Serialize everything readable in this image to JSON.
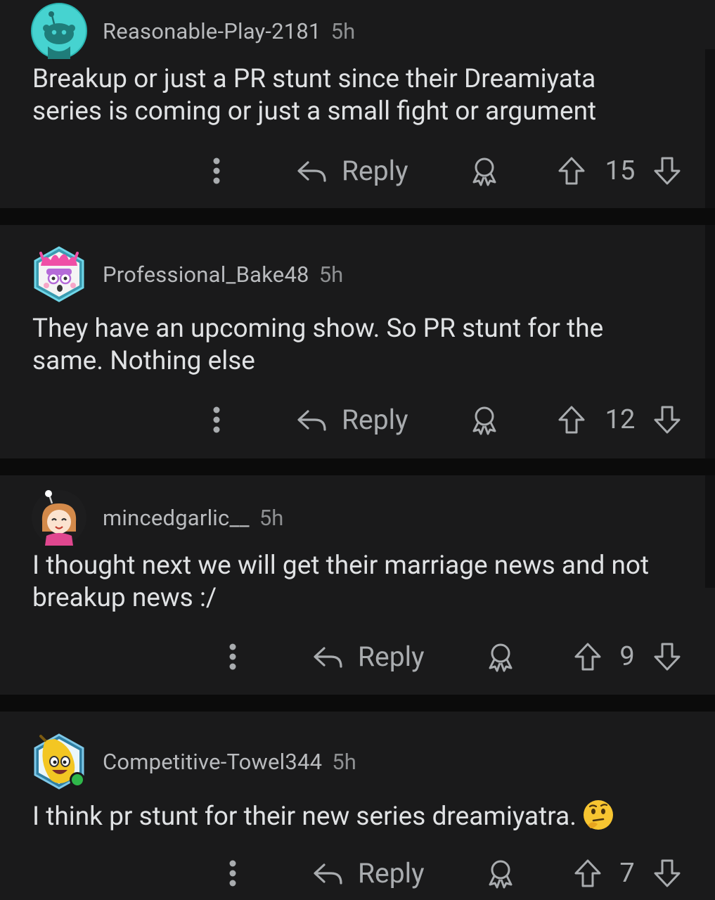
{
  "comments": [
    {
      "username": "Reasonable-Play-2181",
      "time": "5h",
      "text": "Breakup or just a PR stunt since their Dreamiyata series is coming or just a small fight or argument",
      "reply_label": "Reply",
      "score": "15",
      "avatar": "snoo-default-cyan-avatar"
    },
    {
      "username": "Professional_Bake48",
      "time": "5h",
      "text": "They have an upcoming show. So PR stunt for the same. Nothing else",
      "reply_label": "Reply",
      "score": "12",
      "avatar": "pink-monster-hex-avatar"
    },
    {
      "username": "mincedgarlic__",
      "time": "5h",
      "text": "I thought next we will get their marriage news and not breakup news :/",
      "reply_label": "Reply",
      "score": "9",
      "avatar": "cartoon-girl-avatar"
    },
    {
      "username": "Competitive-Towel344",
      "time": "5h",
      "text": "I think pr stunt for their new series dreamiyatra.",
      "reply_label": "Reply",
      "score": "7",
      "avatar": "banana-hex-avatar-online",
      "emoji": "thinking-face-emoji"
    }
  ],
  "colors": {
    "background": "#1a1a1b",
    "separator": "#0b0b0b",
    "text": "#e0e2e4",
    "meta": "#b9bbbe",
    "action": "#a9acaf",
    "online": "#2fb84a"
  }
}
